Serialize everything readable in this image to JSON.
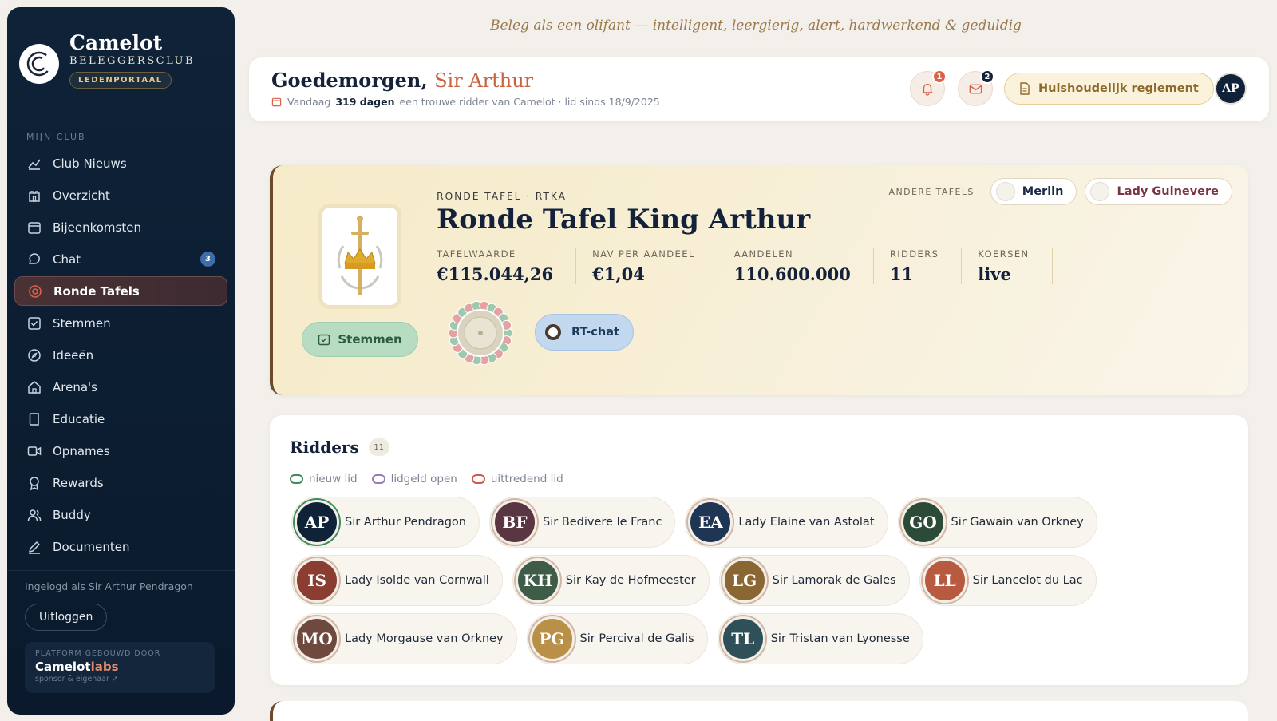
{
  "motto": "Beleg als een olifant — intelligent, leergierig, alert, hardwerkend & geduldig",
  "brand": {
    "title": "Camelot",
    "subtitle": "BELEGGERSCLUB",
    "badge": "LEDENPORTAAL"
  },
  "nav": {
    "section": "MIJN CLUB",
    "items": [
      {
        "label": "Club Nieuws",
        "icon": "chart-line-icon"
      },
      {
        "label": "Overzicht",
        "icon": "castle-icon"
      },
      {
        "label": "Bijeenkomsten",
        "icon": "calendar-icon"
      },
      {
        "label": "Chat",
        "icon": "chat-bubble-icon",
        "badge": "3"
      },
      {
        "label": "Ronde Tafels",
        "icon": "target-icon",
        "active": true
      },
      {
        "label": "Stemmen",
        "icon": "vote-box-icon"
      },
      {
        "label": "Ideeën",
        "icon": "compass-icon"
      },
      {
        "label": "Arena's",
        "icon": "home-icon"
      },
      {
        "label": "Educatie",
        "icon": "book-icon"
      },
      {
        "label": "Opnames",
        "icon": "video-icon"
      },
      {
        "label": "Rewards",
        "icon": "award-icon"
      },
      {
        "label": "Buddy",
        "icon": "users-icon"
      },
      {
        "label": "Documenten",
        "icon": "pen-icon"
      }
    ]
  },
  "sidebar_footer": {
    "logged_in": "Ingelogd als Sir Arthur Pendragon",
    "logout": "Uitloggen",
    "platform_head": "PLATFORM GEBOUWD DOOR",
    "platform_name_a": "Camelot",
    "platform_name_b": "labs",
    "platform_sub": "sponsor & eigenaar ↗"
  },
  "header": {
    "greeting": "Goedemorgen,",
    "name": "Sir Arthur",
    "today": "Vandaag",
    "days": "319 dagen",
    "since_text": "een trouwe ridder van Camelot · lid sinds 18/9/2025",
    "notif_count": "1",
    "mail_count": "2",
    "reglement": "Huishoudelijk reglement",
    "avatar": "AP"
  },
  "table": {
    "kicker": "RONDE TAFEL · RTKA",
    "title": "Ronde Tafel King Arthur",
    "stats": [
      {
        "label": "TAFELWAARDE",
        "value": "€115.044,26"
      },
      {
        "label": "NAV PER AANDEEL",
        "value": "€1,04"
      },
      {
        "label": "AANDELEN",
        "value": "110.600.000"
      },
      {
        "label": "RIDDERS",
        "value": "11"
      },
      {
        "label": "KOERSEN",
        "value": "live"
      }
    ],
    "stemmen": "Stemmen",
    "rtchat": "RT-chat",
    "other_label": "ANDERE TAFELS",
    "other": [
      "Merlin",
      "Lady Guinevere"
    ],
    "other_colors": [
      "#1a2a44",
      "#7a3344"
    ]
  },
  "ridders": {
    "title": "Ridders",
    "count": "11",
    "legend": [
      {
        "label": "nieuw lid",
        "color": "#3f8a5e"
      },
      {
        "label": "lidgeld open",
        "color": "#9a7ab8"
      },
      {
        "label": "uittredend lid",
        "color": "#cc5b4a"
      }
    ],
    "rows": [
      [
        {
          "initials": "AP",
          "name": "Sir Arthur Pendragon",
          "color": "#0f2238",
          "ring": "#3f8a5e"
        },
        {
          "initials": "BF",
          "name": "Sir Bedivere le Franc",
          "color": "#5a3542"
        },
        {
          "initials": "EA",
          "name": "Lady Elaine van Astolat",
          "color": "#1e3554"
        },
        {
          "initials": "GO",
          "name": "Sir Gawain van Orkney",
          "color": "#2c4a38"
        }
      ],
      [
        {
          "initials": "IS",
          "name": "Lady Isolde van Cornwall",
          "color": "#8a3d30"
        },
        {
          "initials": "KH",
          "name": "Sir Kay de Hofmeester",
          "color": "#3f5c48"
        },
        {
          "initials": "LG",
          "name": "Sir Lamorak de Gales",
          "color": "#8a6632"
        },
        {
          "initials": "LL",
          "name": "Sir Lancelot du Lac",
          "color": "#b85a40"
        }
      ],
      [
        {
          "initials": "MO",
          "name": "Lady Morgause van Orkney",
          "color": "#6e4a3e"
        },
        {
          "initials": "PG",
          "name": "Sir Percival de Galis",
          "color": "#b89048"
        },
        {
          "initials": "TL",
          "name": "Sir Tristan van Lyonesse",
          "color": "#2f5058"
        }
      ]
    ]
  }
}
